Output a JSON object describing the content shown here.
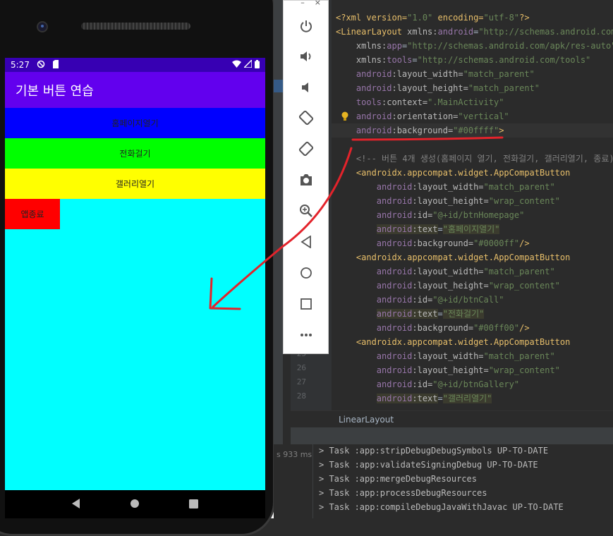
{
  "phone": {
    "status_bar": {
      "time": "5:27"
    },
    "app_title": "기본 버튼 연습",
    "buttons": [
      {
        "label": "홈페이지열기",
        "color": "#0000ff"
      },
      {
        "label": "전화걸기",
        "color": "#00ff00"
      },
      {
        "label": "갤러리열기",
        "color": "#ffff00"
      }
    ],
    "exit_button": {
      "label": "앱종료",
      "color": "#ff0000"
    },
    "background_color": "#00ffff"
  },
  "emulator_toolbar": {
    "window_controls": [
      "–",
      "×"
    ],
    "buttons": [
      "power",
      "volume-up",
      "volume-down",
      "rotate-left",
      "rotate-right",
      "screenshot",
      "zoom",
      "back",
      "home",
      "overview",
      "more"
    ]
  },
  "editor": {
    "line_numbers": {
      "l25": "25",
      "l26": "26",
      "l27": "27",
      "l28": "28"
    },
    "breadcrumb": "LinearLayout"
  },
  "build": {
    "time": "s 933 ms",
    "tasks": [
      "> Task :app:stripDebugDebugSymbols UP-TO-DATE",
      "> Task :app:validateSigningDebug UP-TO-DATE",
      "> Task :app:mergeDebugResources",
      "> Task :app:processDebugResources",
      "> Task :app:compileDebugJavaWithJavac UP-TO-DATE"
    ]
  }
}
